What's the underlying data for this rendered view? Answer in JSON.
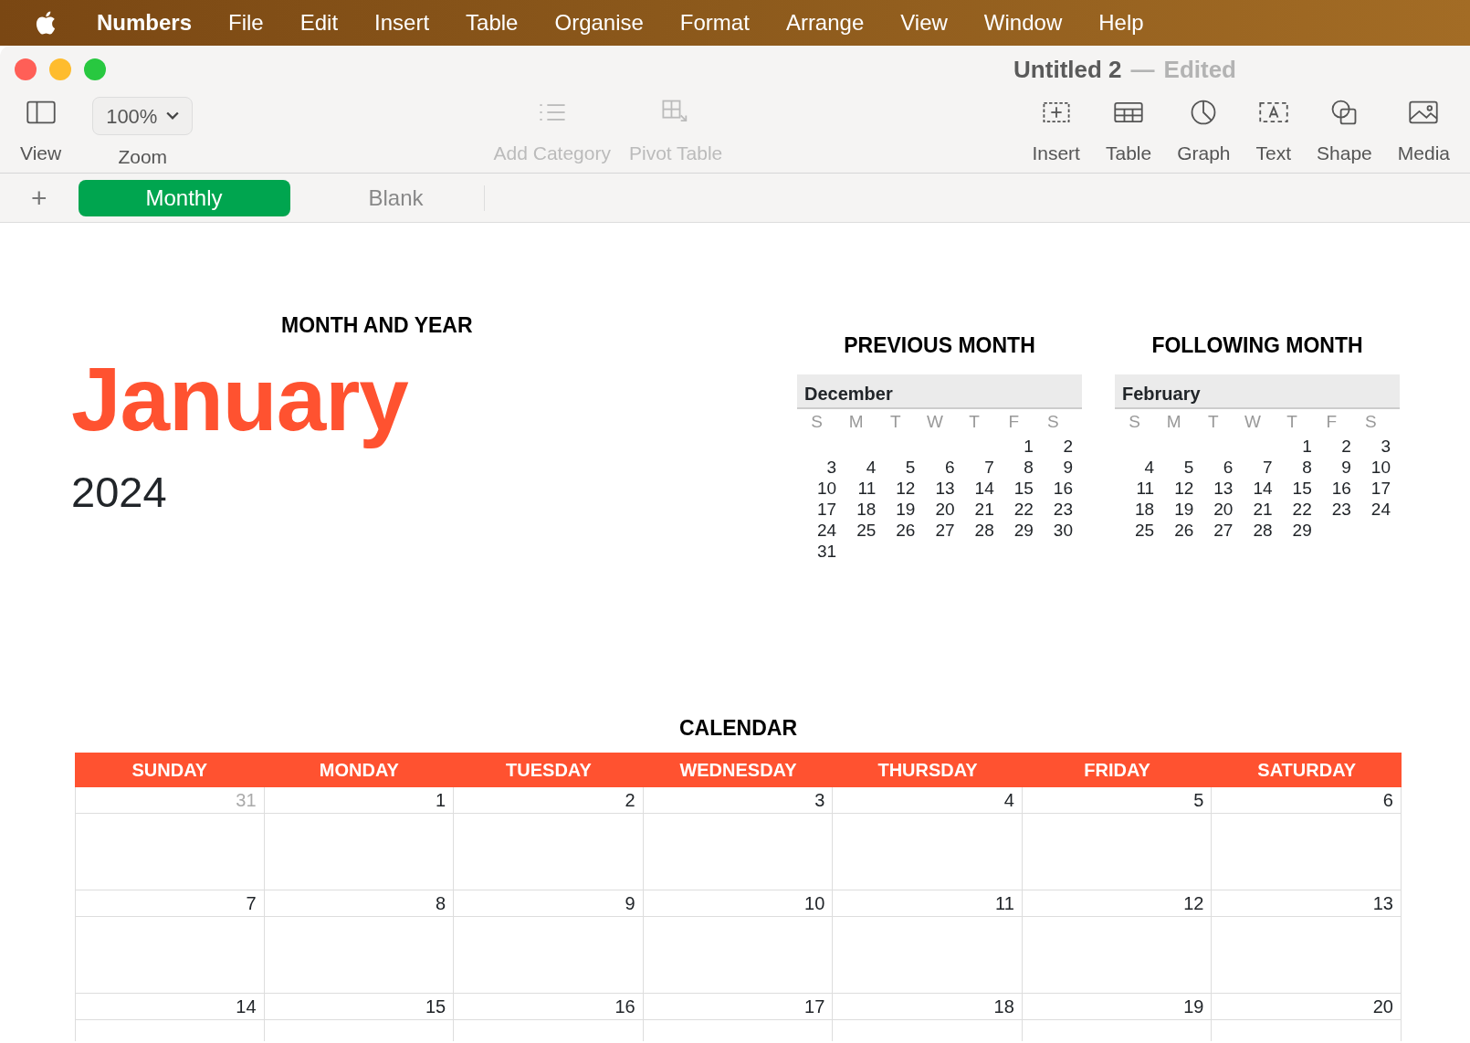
{
  "menu_bar": {
    "app_name": "Numbers",
    "items": [
      "File",
      "Edit",
      "Insert",
      "Table",
      "Organise",
      "Format",
      "Arrange",
      "View",
      "Window",
      "Help"
    ]
  },
  "window": {
    "title": "Untitled 2",
    "separator": "—",
    "status": "Edited"
  },
  "toolbar": {
    "left": [
      {
        "kind": "view",
        "label": "View"
      }
    ],
    "zoom": {
      "value": "100%",
      "label": "Zoom"
    },
    "middle": [
      {
        "kind": "category",
        "label": "Add Category",
        "disabled": true
      },
      {
        "kind": "pivot",
        "label": "Pivot Table",
        "disabled": true
      }
    ],
    "right": [
      {
        "kind": "insert",
        "label": "Insert",
        "disabled": false
      },
      {
        "kind": "table",
        "label": "Table",
        "disabled": false
      },
      {
        "kind": "graph",
        "label": "Graph",
        "disabled": false
      },
      {
        "kind": "text",
        "label": "Text",
        "disabled": false
      },
      {
        "kind": "shape",
        "label": "Shape",
        "disabled": false
      },
      {
        "kind": "media",
        "label": "Media",
        "disabled": false
      }
    ]
  },
  "sheets": {
    "add": "+",
    "tabs": [
      {
        "label": "Monthly",
        "selected": true
      },
      {
        "label": "Blank",
        "selected": false
      }
    ]
  },
  "month_and_year": {
    "heading": "MONTH AND YEAR",
    "month": "January",
    "year": "2024"
  },
  "mini_calendars": [
    {
      "heading": "PREVIOUS MONTH",
      "month": "December",
      "weekdays": [
        "S",
        "M",
        "T",
        "W",
        "T",
        "F",
        "S"
      ],
      "weeks": [
        [
          "1",
          "2"
        ],
        [
          "3",
          "4",
          "5",
          "6",
          "7",
          "8",
          "9"
        ],
        [
          "10",
          "11",
          "12",
          "13",
          "14",
          "15",
          "16"
        ],
        [
          "17",
          "18",
          "19",
          "20",
          "21",
          "22",
          "23"
        ],
        [
          "24",
          "25",
          "26",
          "27",
          "28",
          "29",
          "30"
        ],
        [
          "31"
        ]
      ]
    },
    {
      "heading": "FOLLOWING MONTH",
      "month": "February",
      "weekdays": [
        "S",
        "M",
        "T",
        "W",
        "T",
        "F",
        "S"
      ],
      "weeks": [
        [
          "1",
          "2",
          "3"
        ],
        [
          "4",
          "5",
          "6",
          "7",
          "8",
          "9",
          "10"
        ],
        [
          "11",
          "12",
          "13",
          "14",
          "15",
          "16",
          "17"
        ],
        [
          "18",
          "19",
          "20",
          "21",
          "22",
          "23",
          "24"
        ],
        [
          "25",
          "26",
          "27",
          "28",
          "29"
        ]
      ]
    }
  ],
  "calendar": {
    "heading": "CALENDAR",
    "columns": [
      "SUNDAY",
      "MONDAY",
      "TUESDAY",
      "WEDNESDAY",
      "THURSDAY",
      "FRIDAY",
      "SATURDAY"
    ],
    "rows": [
      [
        {
          "day": "31",
          "outside_month": true
        },
        {
          "day": "1",
          "outside_month": false
        },
        {
          "day": "2",
          "outside_month": false
        },
        {
          "day": "3",
          "outside_month": false
        },
        {
          "day": "4",
          "outside_month": false
        },
        {
          "day": "5",
          "outside_month": false
        },
        {
          "day": "6",
          "outside_month": false
        }
      ],
      [
        {
          "day": "7",
          "outside_month": false
        },
        {
          "day": "8",
          "outside_month": false
        },
        {
          "day": "9",
          "outside_month": false
        },
        {
          "day": "10",
          "outside_month": false
        },
        {
          "day": "11",
          "outside_month": false
        },
        {
          "day": "12",
          "outside_month": false
        },
        {
          "day": "13",
          "outside_month": false
        }
      ],
      [
        {
          "day": "14",
          "outside_month": false
        },
        {
          "day": "15",
          "outside_month": false
        },
        {
          "day": "16",
          "outside_month": false
        },
        {
          "day": "17",
          "outside_month": false
        },
        {
          "day": "18",
          "outside_month": false
        },
        {
          "day": "19",
          "outside_month": false
        },
        {
          "day": "20",
          "outside_month": false
        }
      ]
    ]
  }
}
